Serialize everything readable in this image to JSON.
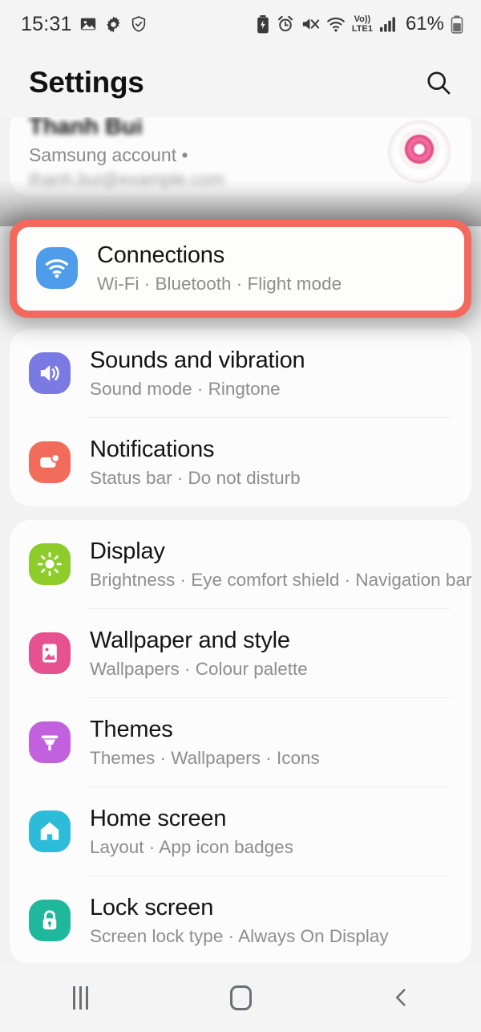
{
  "status_bar": {
    "time": "15:31",
    "left_icons": [
      "gallery-icon",
      "gear-icon",
      "shield-check-icon"
    ],
    "right_icons": [
      "battery-saver-icon",
      "alarm-icon",
      "mute-icon",
      "wifi-icon",
      "volte-icon",
      "signal-icon"
    ],
    "volte_label_top": "Vo))",
    "volte_label_bottom": "LTE1",
    "battery_percent": "61%"
  },
  "app_bar": {
    "title": "Settings",
    "search_icon": "search-icon"
  },
  "account": {
    "name": "Thanh Bui",
    "subtitle": "Samsung account  •",
    "email": "thanh.bui@example.com",
    "avatar": "donut-avatar"
  },
  "highlight": {
    "color": "#f4685e",
    "target": "Connections"
  },
  "sections": [
    {
      "id": "connections",
      "items": [
        {
          "key": "connections",
          "title": "Connections",
          "subtitle": "Wi-Fi  ·  Bluetooth  ·  Flight mode",
          "icon": "wifi-icon",
          "icon_color": "#4f9ceb"
        }
      ]
    },
    {
      "id": "sounds",
      "items": [
        {
          "key": "sounds-and-vibration",
          "title": "Sounds and vibration",
          "subtitle": "Sound mode  ·  Ringtone",
          "icon": "speaker-icon",
          "icon_color": "#7a7ae2"
        },
        {
          "key": "notifications",
          "title": "Notifications",
          "subtitle": "Status bar  ·  Do not disturb",
          "icon": "notification-icon",
          "icon_color": "#f26c5b"
        }
      ]
    },
    {
      "id": "display",
      "items": [
        {
          "key": "display",
          "title": "Display",
          "subtitle": "Brightness  ·  Eye comfort shield  ·  Navigation bar",
          "icon": "brightness-icon",
          "icon_color": "#8ecc2c"
        },
        {
          "key": "wallpaper-and-style",
          "title": "Wallpaper and style",
          "subtitle": "Wallpapers  ·  Colour palette",
          "icon": "picture-icon",
          "icon_color": "#e6518f"
        },
        {
          "key": "themes",
          "title": "Themes",
          "subtitle": "Themes  ·  Wallpapers  ·  Icons",
          "icon": "paintbrush-icon",
          "icon_color": "#c261dd"
        },
        {
          "key": "home-screen",
          "title": "Home screen",
          "subtitle": "Layout  ·  App icon badges",
          "icon": "house-icon",
          "icon_color": "#2cbcd9"
        },
        {
          "key": "lock-screen",
          "title": "Lock screen",
          "subtitle": "Screen lock type  ·  Always On Display",
          "icon": "lock-icon",
          "icon_color": "#1fb89c"
        }
      ]
    }
  ],
  "nav_bar": {
    "recents": "recents-icon",
    "home": "home-icon",
    "back": "back-icon"
  }
}
